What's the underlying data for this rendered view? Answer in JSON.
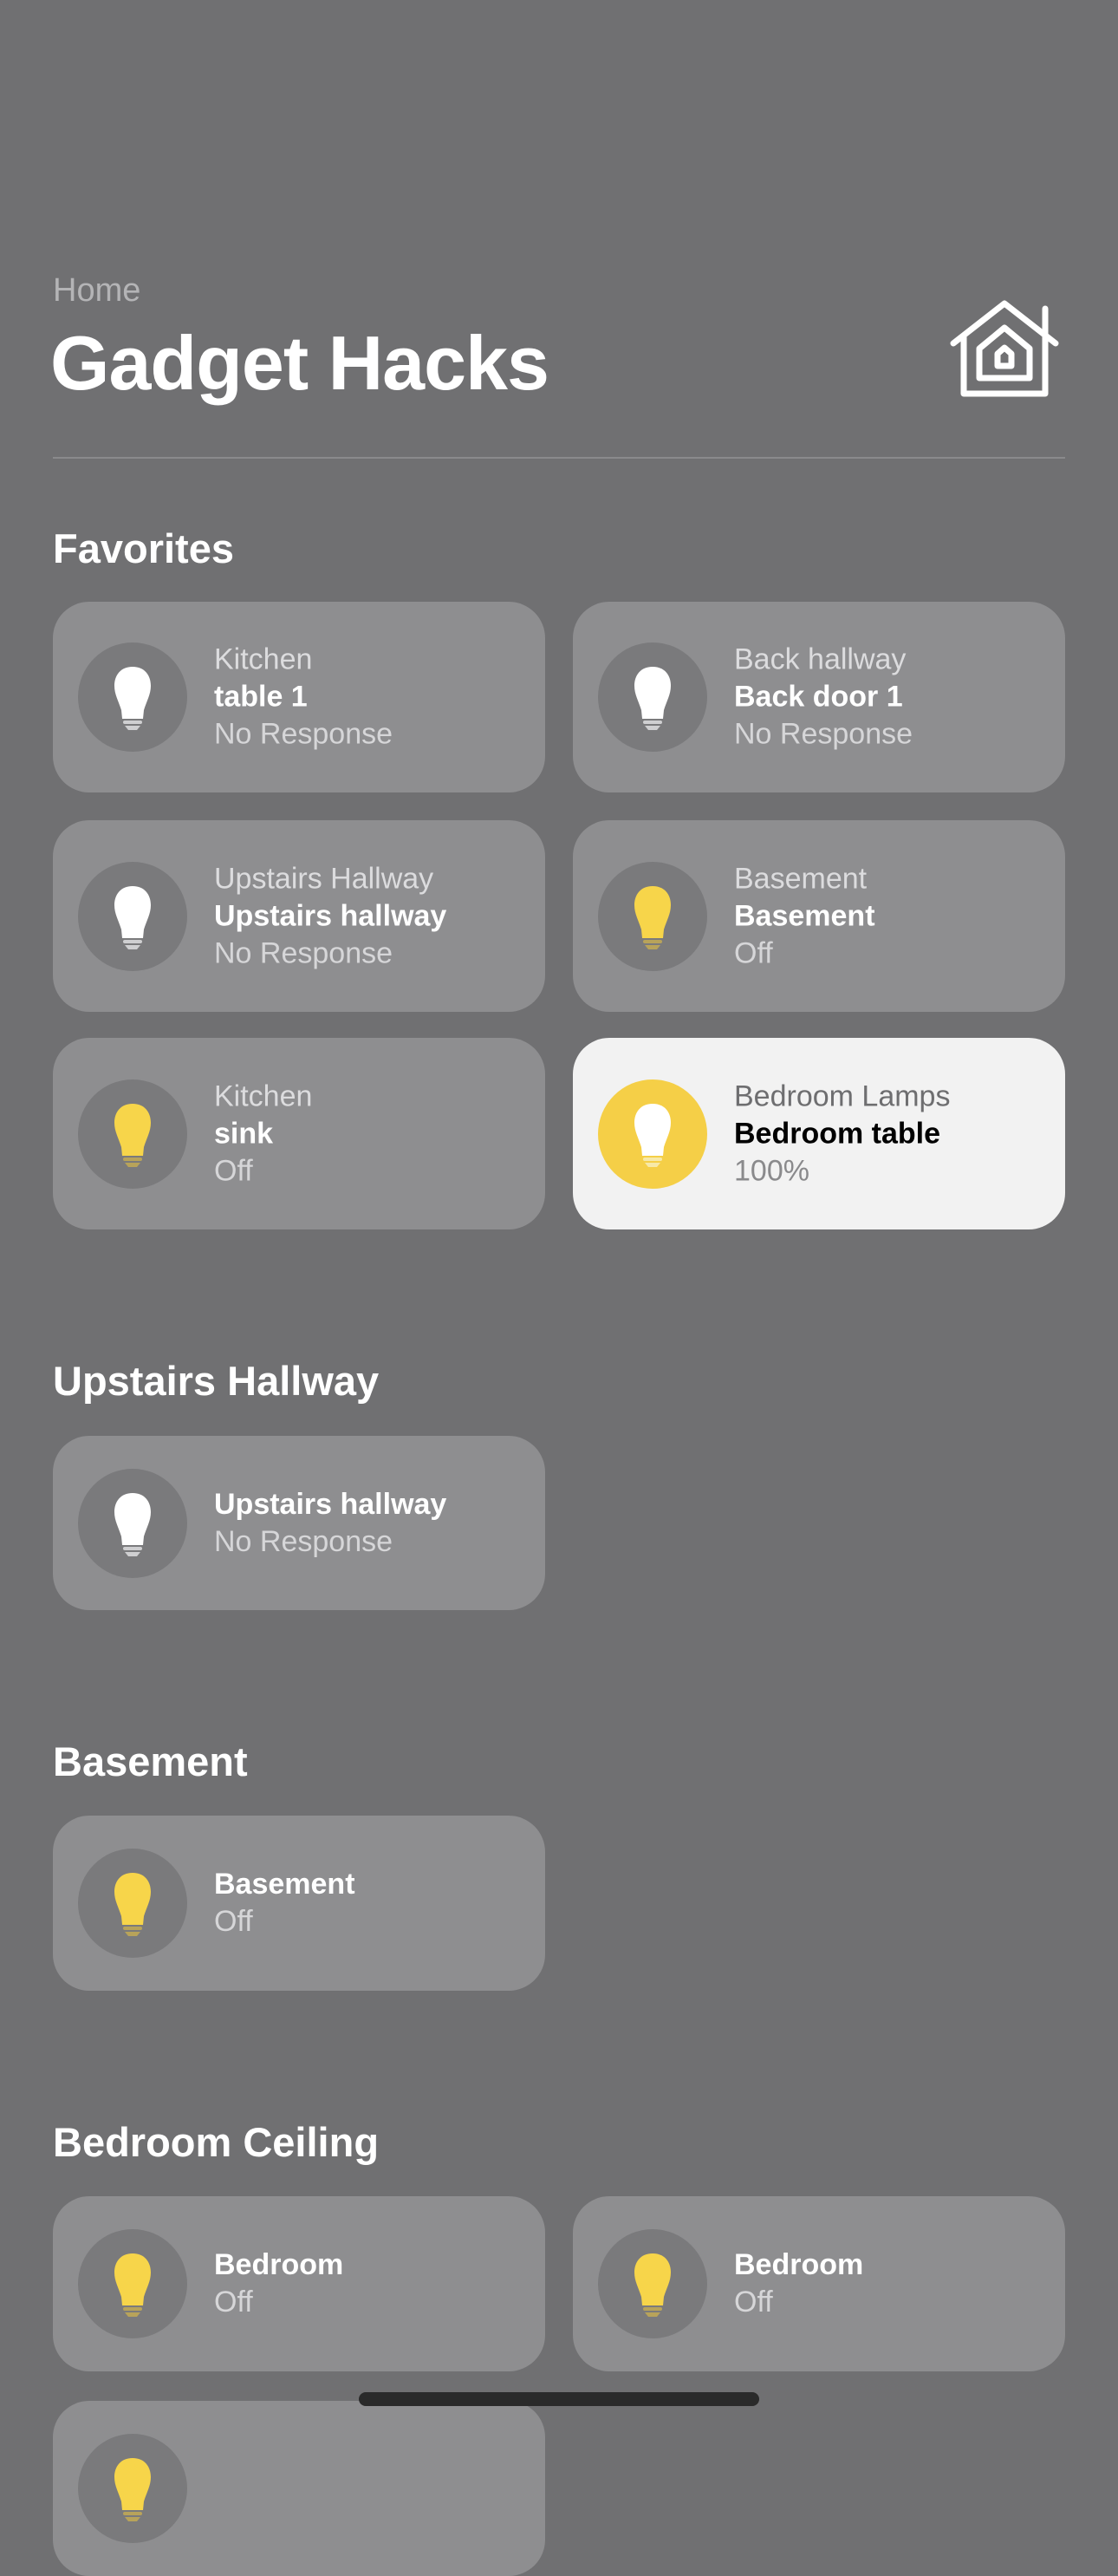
{
  "header": {
    "breadcrumb": "Home",
    "title": "Gadget Hacks",
    "home_icon": "home-icon"
  },
  "colors": {
    "background": "#707072",
    "tile": "#8e8e90",
    "tile_on": "#f2f2f2",
    "bulb_on": "#f5cf47",
    "bulb_off_white": "#ffffff"
  },
  "sections": [
    {
      "title": "Favorites",
      "tiles": [
        {
          "room": "Kitchen",
          "name": "table 1",
          "status": "No Response",
          "bulb": "white",
          "on": false
        },
        {
          "room": "Back hallway",
          "name": "Back door 1",
          "status": "No Response",
          "bulb": "white",
          "on": false
        },
        {
          "room": "Upstairs Hallway",
          "name": "Upstairs hallway",
          "status": "No Response",
          "bulb": "white",
          "on": false
        },
        {
          "room": "Basement",
          "name": "Basement",
          "status": "Off",
          "bulb": "yellow",
          "on": false
        },
        {
          "room": "Kitchen",
          "name": "sink",
          "status": "Off",
          "bulb": "yellow",
          "on": false
        },
        {
          "room": "Bedroom Lamps",
          "name": "Bedroom table",
          "status": "100%",
          "bulb": "lit",
          "on": true
        }
      ]
    },
    {
      "title": "Upstairs Hallway",
      "tiles": [
        {
          "name": "Upstairs hallway",
          "status": "No Response",
          "bulb": "white",
          "on": false
        }
      ]
    },
    {
      "title": "Basement",
      "tiles": [
        {
          "name": "Basement",
          "status": "Off",
          "bulb": "yellow",
          "on": false
        }
      ]
    },
    {
      "title": "Bedroom Ceiling",
      "tiles": [
        {
          "name": "Bedroom",
          "status": "Off",
          "bulb": "yellow",
          "on": false
        },
        {
          "name": "Bedroom",
          "status": "Off",
          "bulb": "yellow",
          "on": false
        },
        {
          "bulb": "yellow",
          "on": false
        }
      ]
    }
  ]
}
